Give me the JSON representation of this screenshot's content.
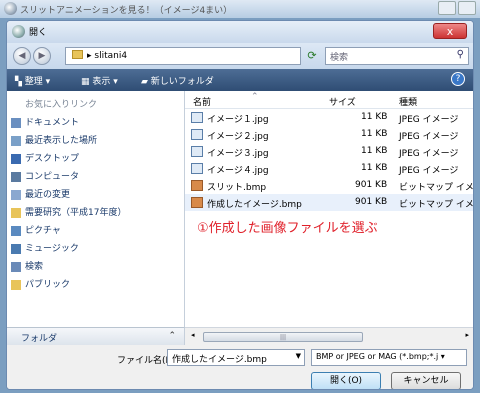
{
  "outer_window": {
    "title": "スリットアニメーションを見る！（イメージ4まい）"
  },
  "dialog": {
    "title": "開く",
    "close_label": "x"
  },
  "address": {
    "path": "slitani4",
    "search_placeholder": "検索"
  },
  "toolbar": {
    "organize": "整理 ▾",
    "view": "表示 ▾",
    "new_folder": "新しいフォルダ",
    "help": "?"
  },
  "nav": {
    "header": "お気に入りリンク",
    "items": [
      "ドキュメント",
      "最近表示した場所",
      "デスクトップ",
      "コンピュータ",
      "最近の変更",
      "需要研究（平成17年度）",
      "ピクチャ",
      "ミュージック",
      "検索",
      "パブリック"
    ],
    "folder_label": "フォルダ"
  },
  "file_list": {
    "columns": [
      "名前",
      "サイズ",
      "種類"
    ],
    "rows": [
      {
        "name": "イメージ１.jpg",
        "size": "11 KB",
        "type": "JPEG イメージ"
      },
      {
        "name": "イメージ２.jpg",
        "size": "11 KB",
        "type": "JPEG イメージ"
      },
      {
        "name": "イメージ３.jpg",
        "size": "11 KB",
        "type": "JPEG イメージ"
      },
      {
        "name": "イメージ４.jpg",
        "size": "11 KB",
        "type": "JPEG イメージ"
      },
      {
        "name": "スリット.bmp",
        "size": "901 KB",
        "type": "ビットマップ イメ"
      },
      {
        "name": "作成したイメージ.bmp",
        "size": "901 KB",
        "type": "ビットマップ イメ"
      }
    ],
    "annotation": "①作成した画像ファイルを選ぶ"
  },
  "bottom": {
    "filename_label": "ファイル名(N):",
    "filename_value": "作成したイメージ.bmp",
    "filetype": "BMP or JPEG or MAG (*.bmp;*.j ▾",
    "open_label": "開く(O)",
    "cancel_label": "キャンセル"
  },
  "colors": {
    "annotation": "#e0202a",
    "toolbar": "#3a5a84"
  }
}
